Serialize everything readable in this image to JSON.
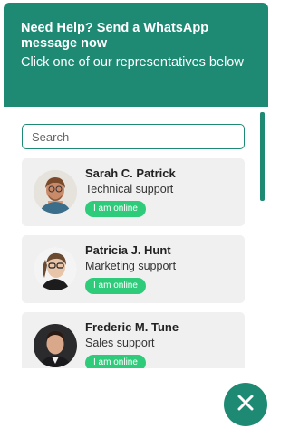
{
  "header": {
    "title": "Need Help? Send a WhatsApp message now",
    "subtitle": "Click one of our representatives below"
  },
  "search": {
    "placeholder": "Search"
  },
  "agents": [
    {
      "name": "Sarah C. Patrick",
      "role": "Technical support",
      "status": "I am online"
    },
    {
      "name": "Patricia J. Hunt",
      "role": "Marketing support",
      "status": "I am online"
    },
    {
      "name": "Frederic M. Tune",
      "role": "Sales support",
      "status": "I am online"
    }
  ],
  "close_button": {
    "icon": "close-icon"
  },
  "colors": {
    "brand": "#1e8a74",
    "online_badge": "#2ecc7a",
    "card_bg": "#f0f0f0"
  }
}
